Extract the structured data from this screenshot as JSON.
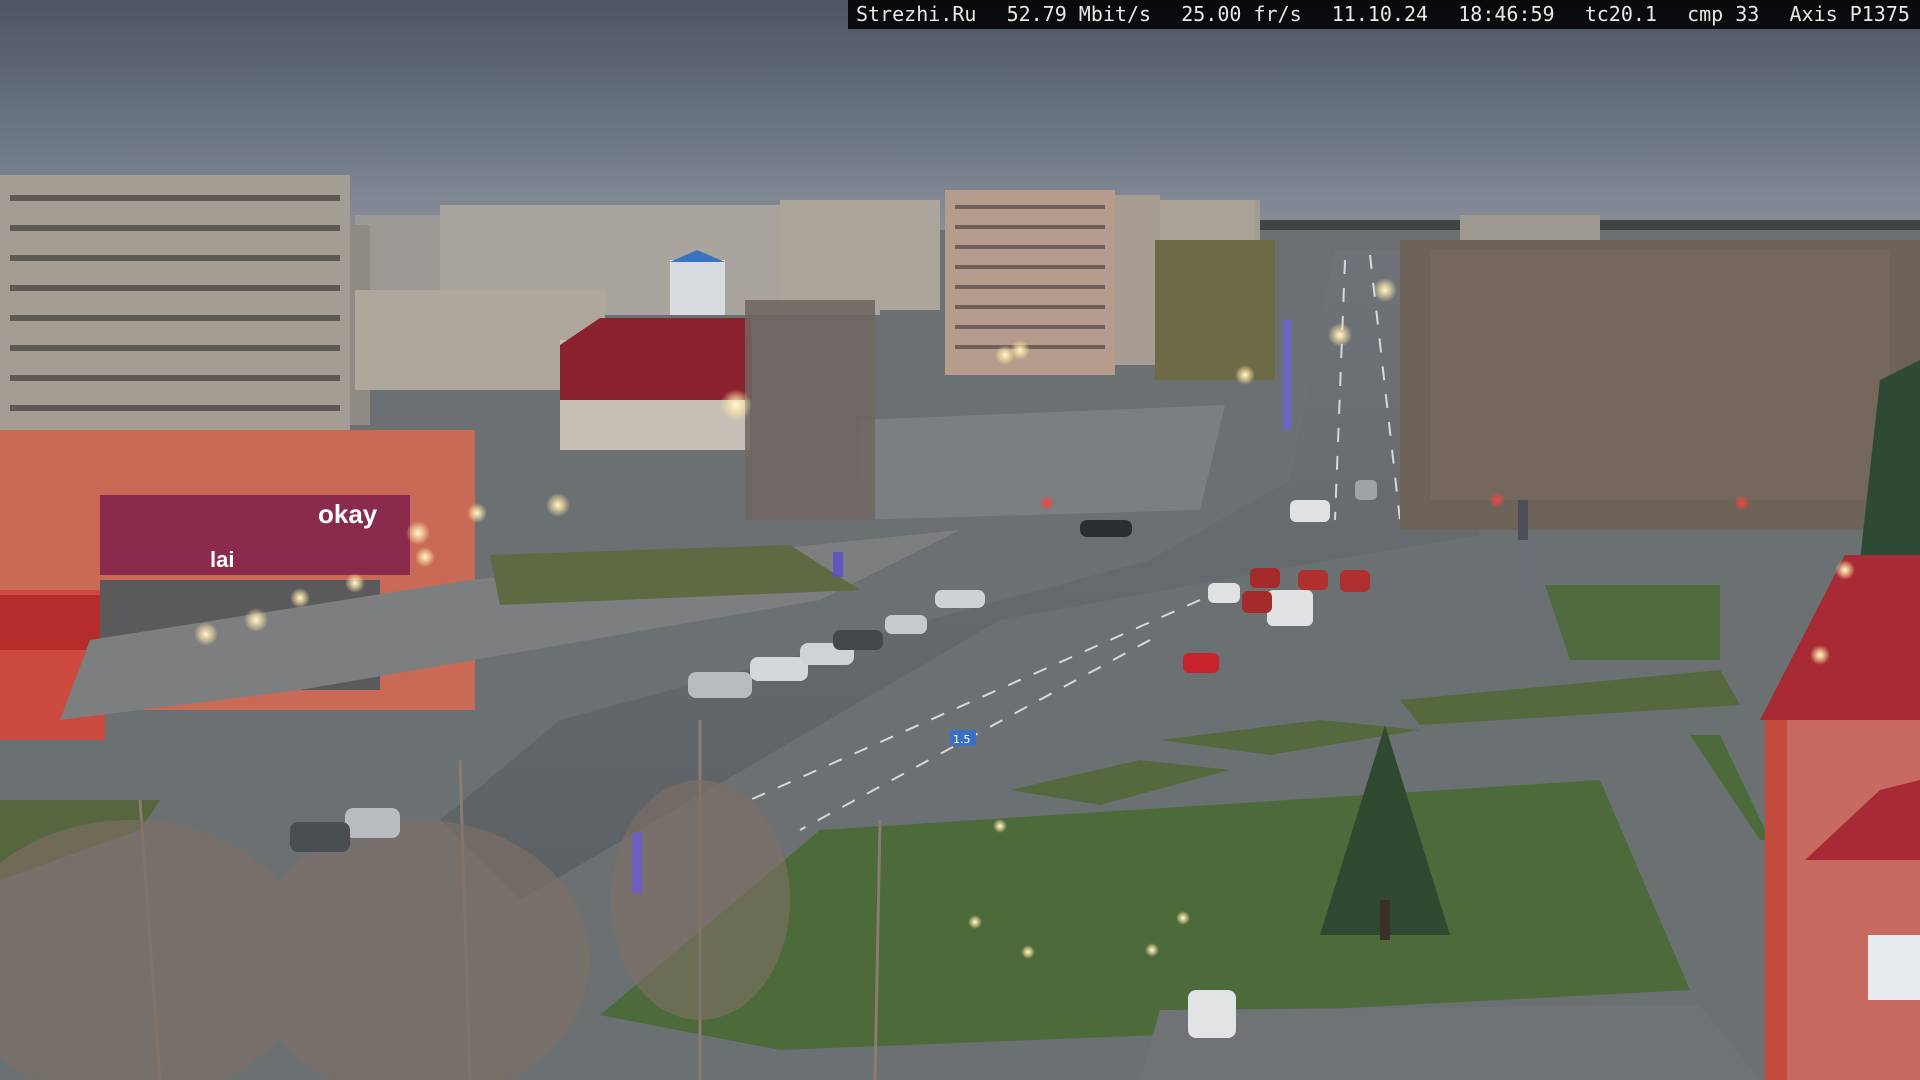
{
  "overlay": {
    "site": "Strezhi.Ru",
    "bitrate": "52.79 Mbit/s",
    "framerate": "25.00 fr/s",
    "date": "11.10.24",
    "time": "18:46:59",
    "tc": "tc20.1",
    "cmp": "cmp 33",
    "camera_model": "Axis P1375"
  },
  "signs": {
    "store_sign": "okay",
    "store_sign_small": "lai",
    "road_sign": "1.5"
  }
}
